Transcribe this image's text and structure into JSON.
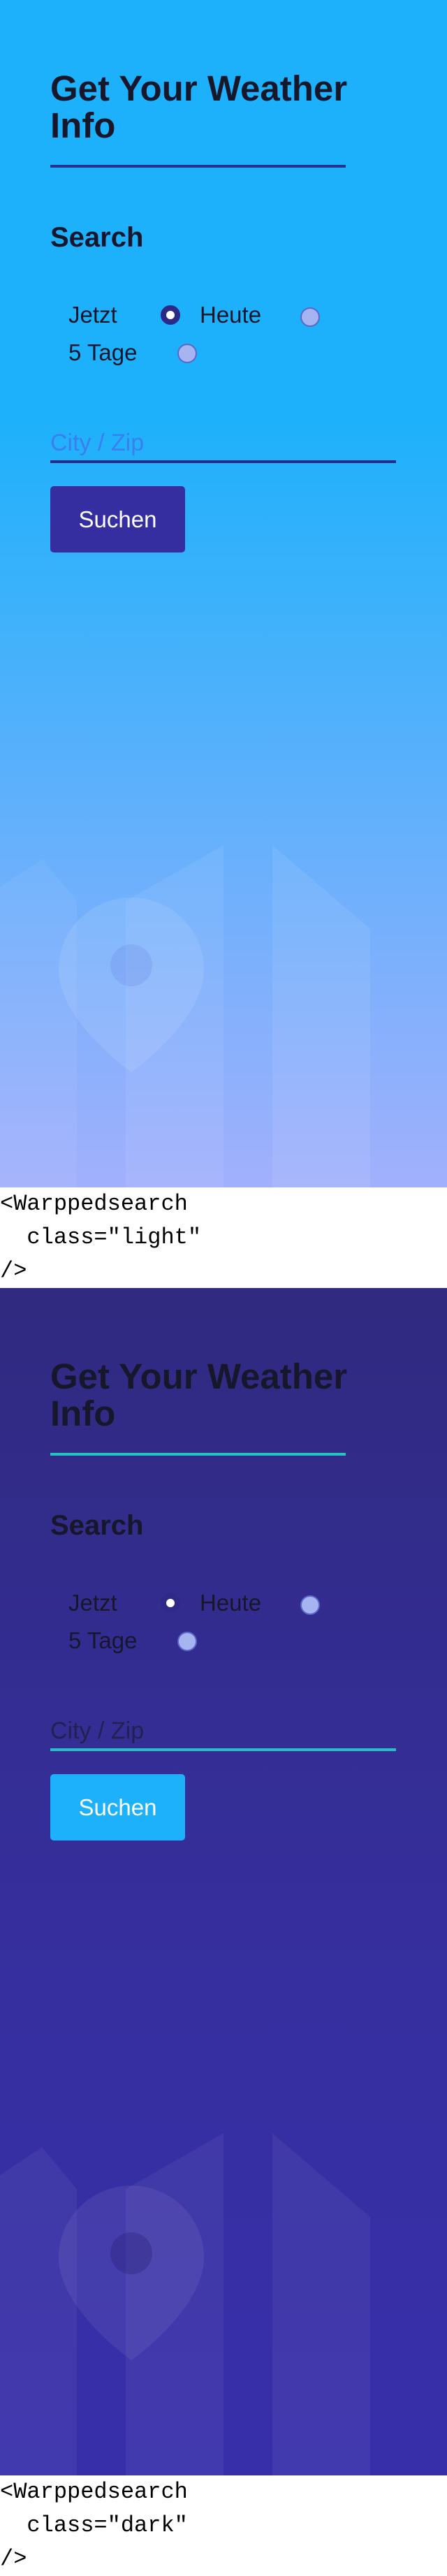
{
  "light": {
    "title": "Get Your Weather Info",
    "subtitle": "Search",
    "radios": [
      {
        "label": "Jetzt",
        "checked": true
      },
      {
        "label": "Heute",
        "checked": false
      },
      {
        "label": "5 Tage",
        "checked": false
      }
    ],
    "input_placeholder": "City / Zip",
    "button_label": "Suchen",
    "colors": {
      "background_top": "#1db1fb",
      "background_bottom": "#a2b0fc",
      "accent": "#342ea1"
    },
    "illustration_icon": "map-pin-icon"
  },
  "light_code": "<Warppedsearch\n  class=\"light\"\n/>",
  "dark": {
    "title": "Get Your Weather Info",
    "subtitle": "Search",
    "radios": [
      {
        "label": "Jetzt",
        "checked": true
      },
      {
        "label": "Heute",
        "checked": false
      },
      {
        "label": "5 Tage",
        "checked": false
      }
    ],
    "input_placeholder": "City / Zip",
    "button_label": "Suchen",
    "colors": {
      "background_top": "#302a80",
      "background_bottom": "#372faa",
      "accent": "#26c2c3",
      "button": "#1db1fb"
    },
    "illustration_icon": "map-pin-icon"
  },
  "dark_code": "<Warppedsearch\n  class=\"dark\"\n/>"
}
